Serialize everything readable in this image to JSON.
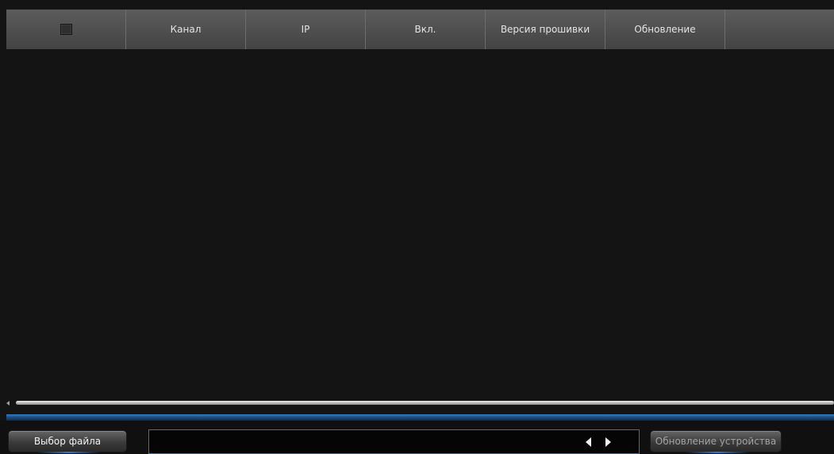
{
  "table": {
    "columns": [
      "Канал",
      "IP",
      "Вкл.",
      "Версия прошивки",
      "Обновление",
      ""
    ],
    "rows": []
  },
  "footer": {
    "choose_file_label": "Выбор файла",
    "file_path_value": "",
    "update_device_label": "Обновление устройства"
  },
  "colors": {
    "background": "#141414",
    "header": "#4e4e4e",
    "accent": "#2e73b8"
  }
}
